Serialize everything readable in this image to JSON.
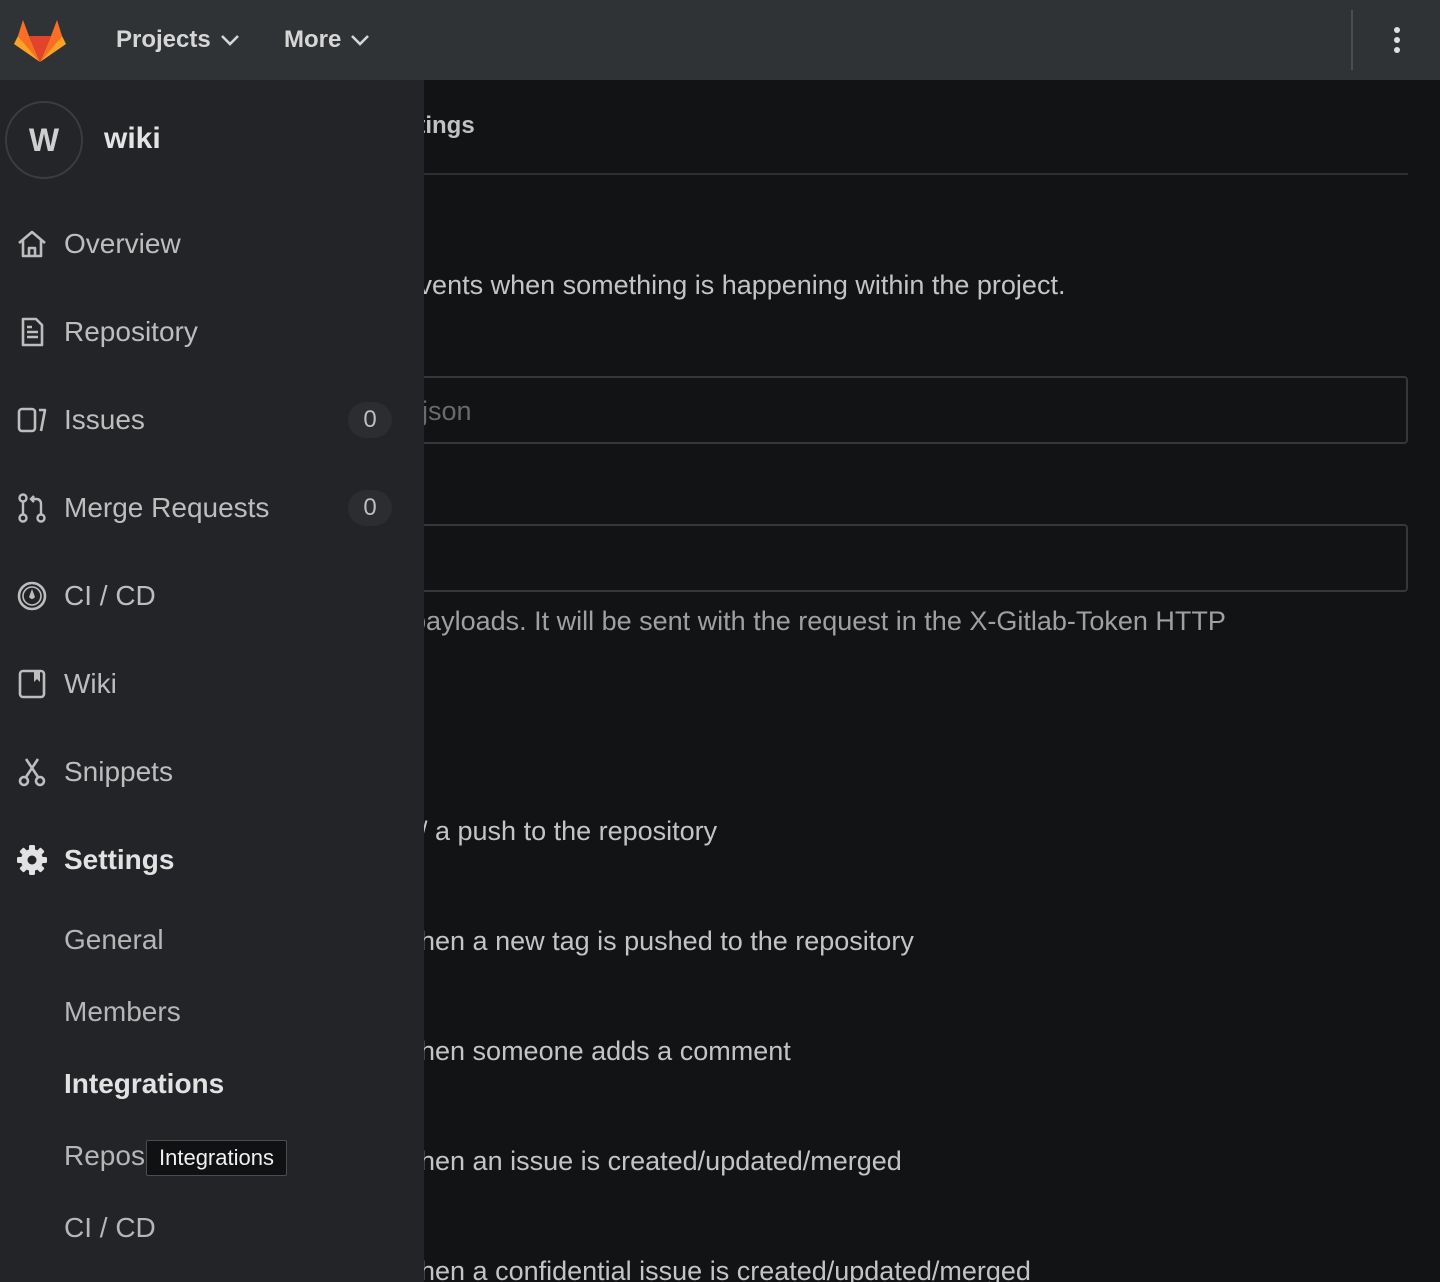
{
  "navbar": {
    "projects_label": "Projects",
    "more_label": "More"
  },
  "sidebar": {
    "project_initial": "W",
    "project_name": "wiki",
    "items": [
      {
        "label": "Overview",
        "icon": "home-icon"
      },
      {
        "label": "Repository",
        "icon": "document-icon"
      },
      {
        "label": "Issues",
        "icon": "issues-icon",
        "count": "0"
      },
      {
        "label": "Merge Requests",
        "icon": "merge-request-icon",
        "count": "0"
      },
      {
        "label": "CI / CD",
        "icon": "rocket-icon"
      },
      {
        "label": "Wiki",
        "icon": "book-icon"
      },
      {
        "label": "Snippets",
        "icon": "scissors-icon"
      },
      {
        "label": "Settings",
        "icon": "gear-icon"
      }
    ],
    "settings_sub": [
      {
        "label": "General"
      },
      {
        "label": "Members"
      },
      {
        "label": "Integrations",
        "active": true
      },
      {
        "label": "Repos"
      },
      {
        "label": "CI / CD"
      }
    ],
    "tooltip": "Integrations"
  },
  "main": {
    "breadcrumb_tail": "s Settings",
    "description_fragment": "ing events when something is happening within the project.",
    "url_placeholder_fragment": "json",
    "token_help_fragment": "ved payloads. It will be sent with the request in the X-Gitlab-Token HTTP",
    "triggers": [
      "/ a push to the repository",
      "hen a new tag is pushed to the repository",
      "hen someone adds a comment",
      "hen an issue is created/updated/merged",
      "hen a confidential issue is created/updated/merged"
    ]
  },
  "colors": {
    "navbar_bg": "#2f3336",
    "sidebar_bg": "#222427",
    "content_bg": "#121315",
    "logo_orange": "#fc6d26"
  }
}
